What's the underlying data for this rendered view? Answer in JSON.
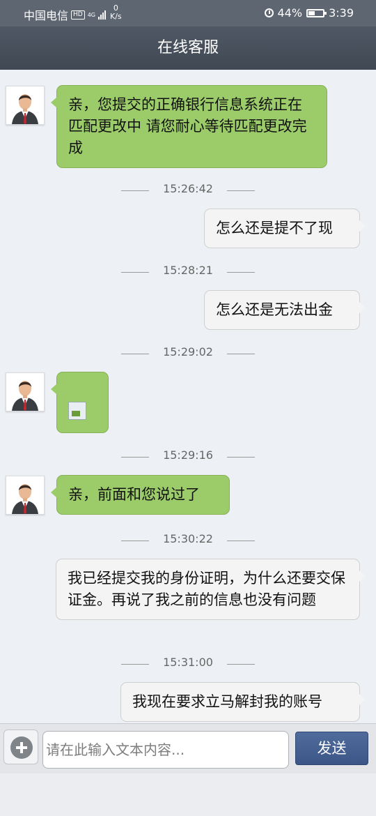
{
  "status_bar": {
    "carrier": "中国电信",
    "hd_badge": "HD",
    "network": "4G",
    "speed_value": "0",
    "speed_unit": "K/s",
    "battery": "44%",
    "time": "3:39"
  },
  "header": {
    "title": "在线客服"
  },
  "messages": [
    {
      "id": "m1",
      "from": "agent",
      "type": "text",
      "text": "亲，您提交的正确银行信息系统正在匹配更改中  请您耐心等待匹配更改完成"
    },
    {
      "id": "t1",
      "type": "timestamp",
      "text": "15:26:42"
    },
    {
      "id": "m2",
      "from": "user",
      "type": "text",
      "text": "怎么还是提不了现"
    },
    {
      "id": "t2",
      "type": "timestamp",
      "text": "15:28:21"
    },
    {
      "id": "m3",
      "from": "user",
      "type": "text",
      "text": "怎么还是无法出金"
    },
    {
      "id": "t3",
      "type": "timestamp",
      "text": "15:29:02"
    },
    {
      "id": "m4",
      "from": "agent",
      "type": "image",
      "icon": "broken-image-icon"
    },
    {
      "id": "t4",
      "type": "timestamp",
      "text": "15:29:16"
    },
    {
      "id": "m5",
      "from": "agent",
      "type": "text",
      "text": "亲，前面和您说过了"
    },
    {
      "id": "t5",
      "type": "timestamp",
      "text": "15:30:22"
    },
    {
      "id": "m6",
      "from": "user",
      "type": "text",
      "text": "我已经提交我的身份证明，为什么还要交保证金。再说了我之前的信息也没有问题"
    },
    {
      "id": "t6",
      "type": "timestamp",
      "text": "15:31:00"
    },
    {
      "id": "m7",
      "from": "user",
      "type": "text",
      "text": "我现在要求立马解封我的账号"
    }
  ],
  "input_bar": {
    "add_icon": "plus-icon",
    "placeholder": "请在此输入文本内容...",
    "value": "",
    "send_label": "发送"
  },
  "colors": {
    "status_bar_bg": "#5d6671",
    "header_bg": "#454e59",
    "chat_bg": "#edf0f5",
    "agent_bubble": "#9ccc6a",
    "user_bubble": "#f4f4f4",
    "send_button": "#44609a"
  }
}
